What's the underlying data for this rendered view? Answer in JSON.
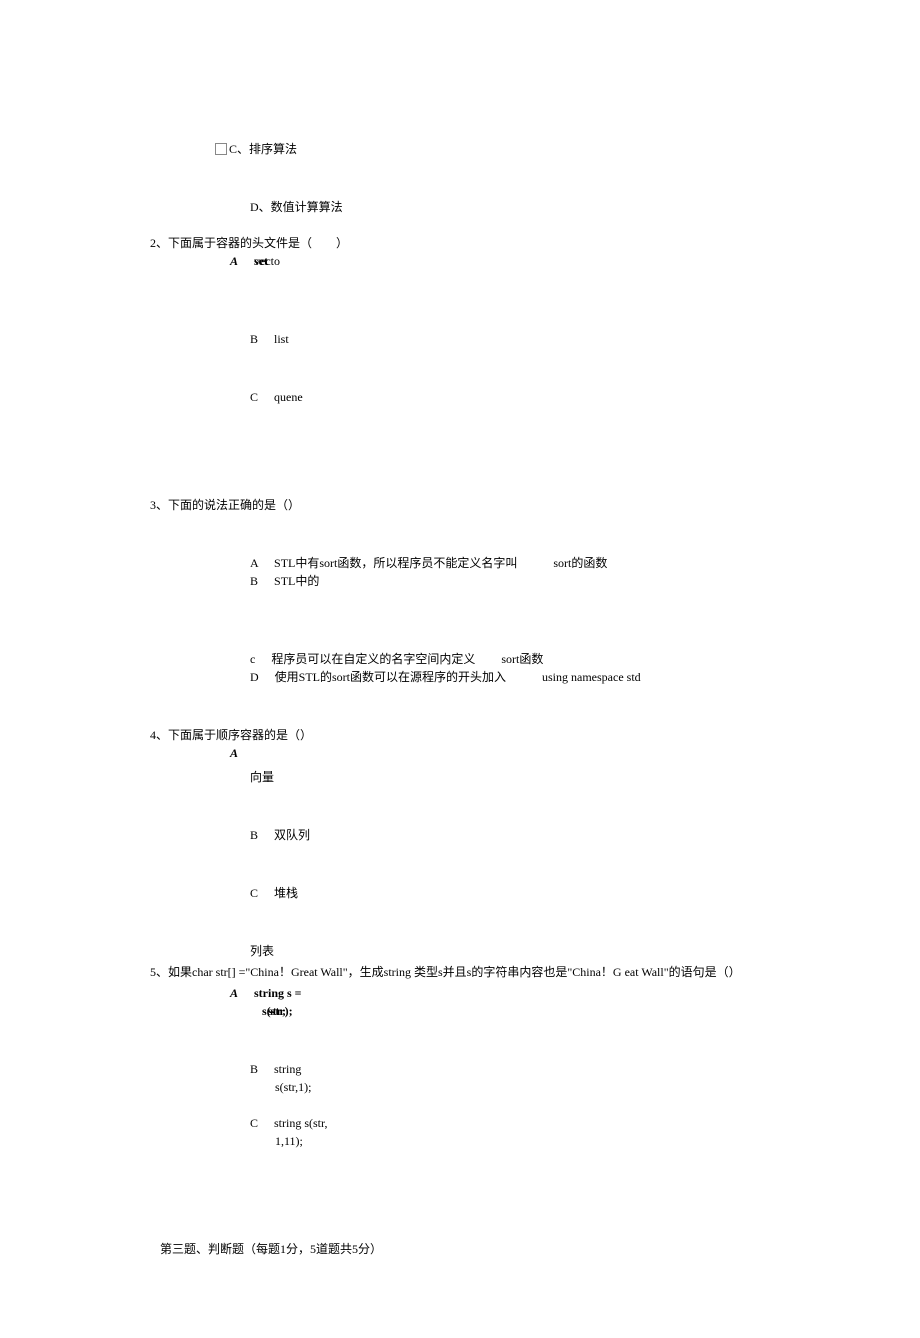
{
  "q1": {
    "optC": "C、排序算法",
    "optD": "D、数值计算算法"
  },
  "q2": {
    "stem": "2、下面属于容器的头文件是（　　）",
    "optA_label": "A",
    "optA_text": "vecto",
    "optA_text_overlay": "set",
    "optB_label": "B",
    "optB_text": "list",
    "optC_label": "C",
    "optC_text": "quene"
  },
  "q3": {
    "stem": "3、下面的说法正确的是（）",
    "optA_label": "A",
    "optA_text1": "STL中有sort函数，所以程序员不能定义名字叫",
    "optA_text2": "sort的函数",
    "optB_label": "B",
    "optB_text": "STL中的",
    "optc_label": "c",
    "optc_text1": "程序员可以在自定义的名字空间内定义",
    "optc_text2": "sort函数",
    "optD_label": "D",
    "optD_text1": "使用STL的sort函数可以在源程序的开头加入",
    "optD_text2": "using namespace std"
  },
  "q4": {
    "stem": "4、下面属于顺序容器的是（）",
    "optA_label": "A",
    "optA_line2": "向量",
    "optB_label": "B",
    "optB_text": "双队列",
    "optC_label": "C",
    "optC_text": "堆栈",
    "optD_text": "列表"
  },
  "q5": {
    "stem_part1": "5、如果char str[] =\"China！Great Wall\"，生成string 类型s并且s的字符串内容也是\"China！G eat Wall\"的语句是（）",
    "optA_label": "A",
    "optA_line1": "string s =",
    "optA_line2a": "s(str);",
    "optA_line2b": "str;",
    "optB_label": "B",
    "optB_line1": "string",
    "optB_line2": "s(str,1);",
    "optC_label": "C",
    "optC_line1": "string s(str,",
    "optC_line2": "1,11);"
  },
  "section3": {
    "title": "第三题、判断题（每题1分，5道题共5分）"
  }
}
